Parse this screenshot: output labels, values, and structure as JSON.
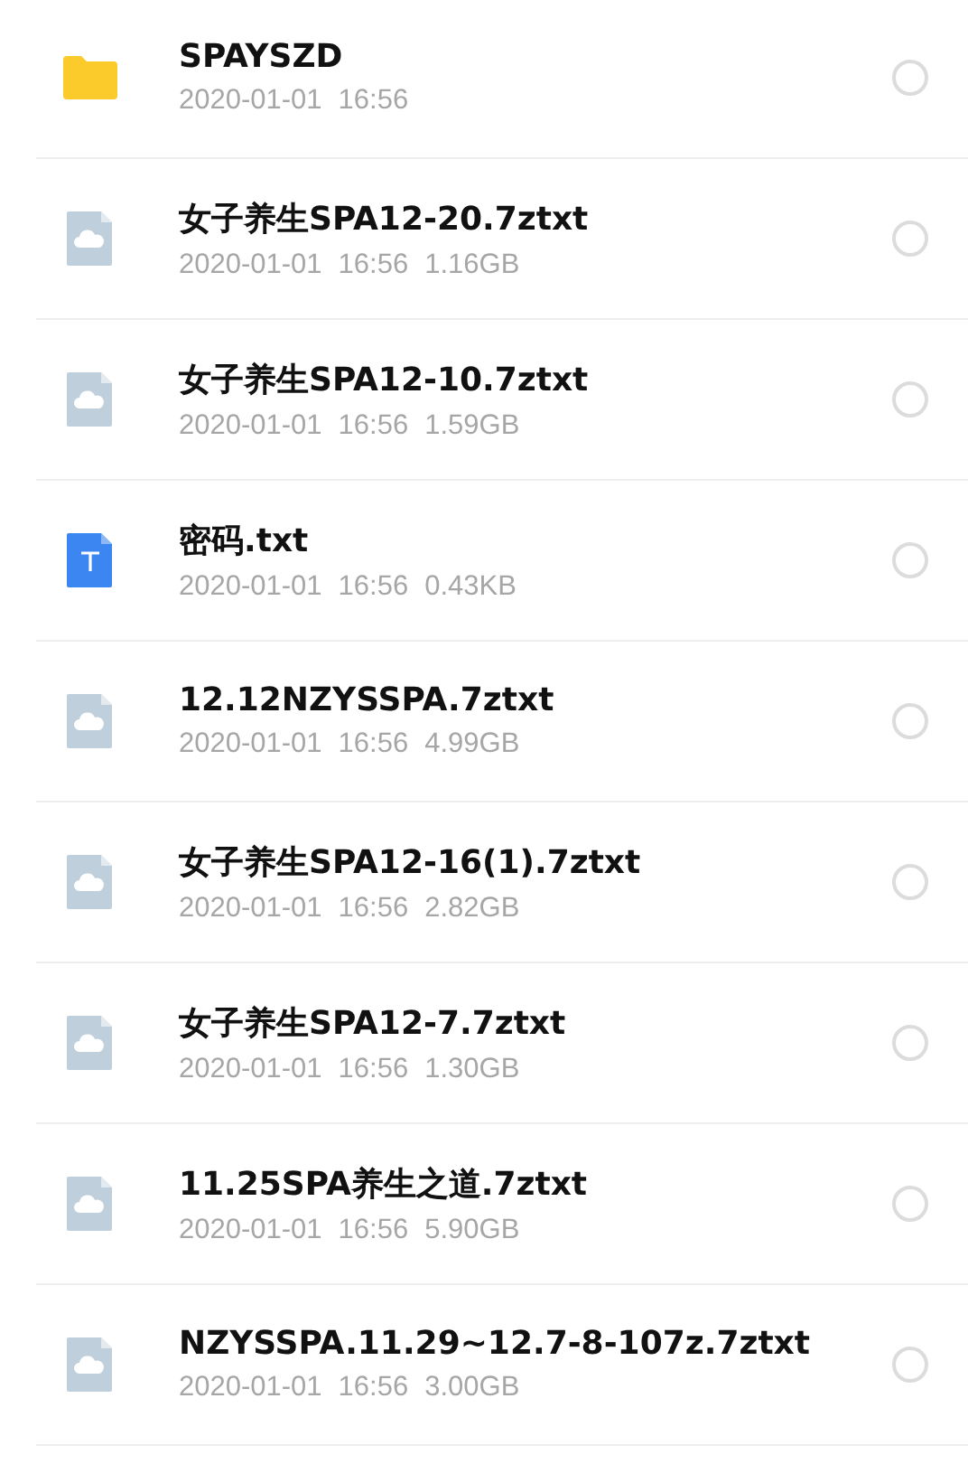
{
  "files": [
    {
      "kind": "folder",
      "name": "SPAYSZD",
      "date": "2020-01-01",
      "time": "16:56",
      "selected": false
    },
    {
      "kind": "cloud",
      "name": "女子养生SPA12-20.7ztxt",
      "date": "2020-01-01",
      "time": "16:56",
      "size": "1.16GB",
      "selected": false
    },
    {
      "kind": "cloud",
      "name": "女子养生SPA12-10.7ztxt",
      "date": "2020-01-01",
      "time": "16:56",
      "size": "1.59GB",
      "selected": false
    },
    {
      "kind": "text",
      "name": "密码.txt",
      "date": "2020-01-01",
      "time": "16:56",
      "size": "0.43KB",
      "selected": false
    },
    {
      "kind": "cloud",
      "name": "12.12NZYSSPA.7ztxt",
      "date": "2020-01-01",
      "time": "16:56",
      "size": "4.99GB",
      "selected": false
    },
    {
      "kind": "cloud",
      "name": "女子养生SPA12-16(1).7ztxt",
      "date": "2020-01-01",
      "time": "16:56",
      "size": "2.82GB",
      "selected": false
    },
    {
      "kind": "cloud",
      "name": "女子养生SPA12-7.7ztxt",
      "date": "2020-01-01",
      "time": "16:56",
      "size": "1.30GB",
      "selected": false
    },
    {
      "kind": "cloud",
      "name": "11.25SPA养生之道.7ztxt",
      "date": "2020-01-01",
      "time": "16:56",
      "size": "5.90GB",
      "selected": false
    },
    {
      "kind": "cloud",
      "name": "NZYSSPA.11.29~12.7-8-107z.7ztxt",
      "date": "2020-01-01",
      "time": "16:56",
      "size": "3.00GB",
      "selected": false
    }
  ]
}
